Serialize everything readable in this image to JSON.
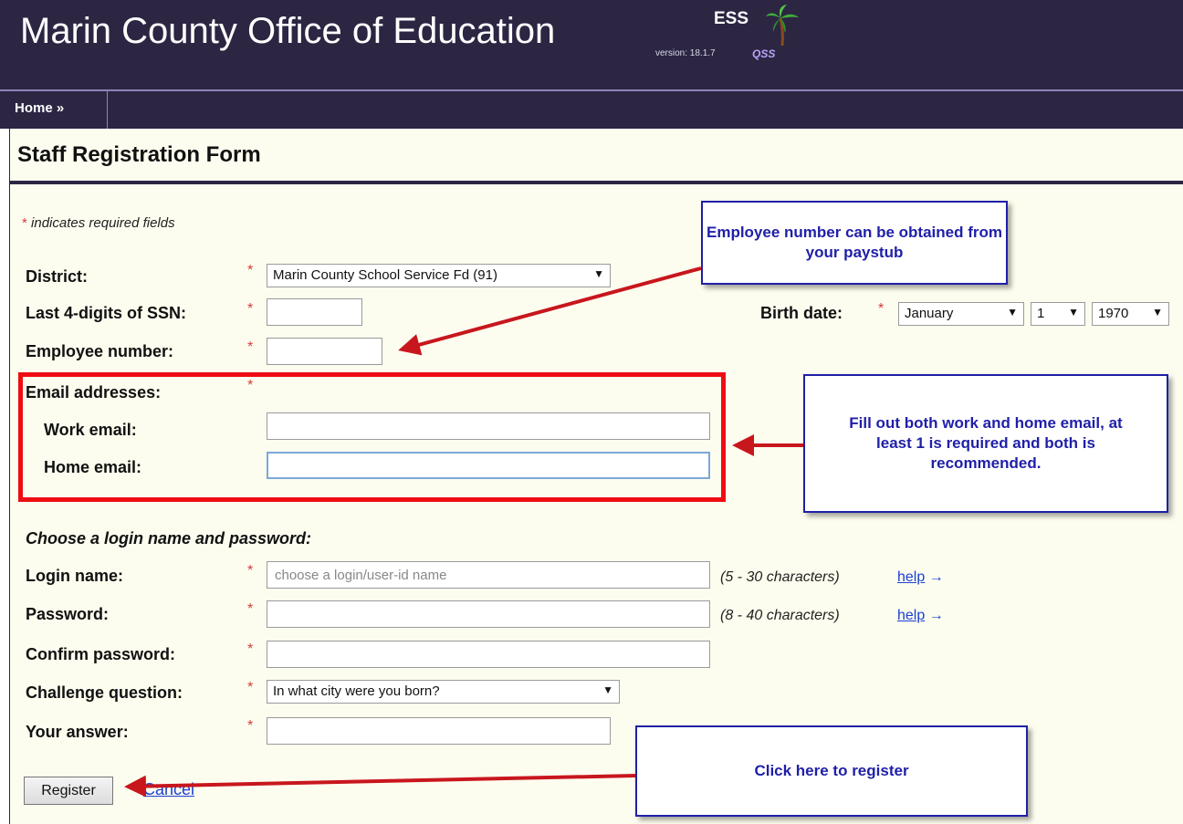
{
  "header": {
    "site_title": "Marin County Office of Education",
    "app_name": "ESS",
    "version": "version: 18.1.7",
    "brand": "QSS"
  },
  "nav": {
    "home": "Home »"
  },
  "form": {
    "title": "Staff Registration Form",
    "required_note": "indicates required fields",
    "required_star": "*",
    "district_label": "District:",
    "district_value": "Marin County School Service Fd (91)",
    "ssn_label": "Last 4-digits of SSN:",
    "birthdate_label": "Birth date:",
    "birth_month": "January",
    "birth_day": "1",
    "birth_year": "1970",
    "employee_label": "Employee number:",
    "email_label": "Email addresses:",
    "work_email_label": "Work email:",
    "home_email_label": "Home email:",
    "login_section": "Choose a login name and password:",
    "login_label": "Login name:",
    "login_placeholder": "choose a login/user-id name",
    "login_hint": "(5 - 30 characters)",
    "password_label": "Password:",
    "password_hint": "(8 - 40 characters)",
    "help_link": "help",
    "help_arrow": "→",
    "confirm_label": "Confirm password:",
    "challenge_label": "Challenge question:",
    "challenge_value": "In what city were you born?",
    "answer_label": "Your answer:",
    "register_button": "Register",
    "cancel_link": "Cancel"
  },
  "callouts": {
    "employee": "Employee number can be obtained from your paystub",
    "email": "Fill out both work and home email, at least 1 is required and both is recommended.",
    "register": "Click here to register"
  },
  "colors": {
    "header_bg": "#2c2643",
    "page_bg": "#fdfdef",
    "callout_border": "#1f1fa8",
    "highlight_red": "#ee0d12",
    "arrow_red": "#c8161d",
    "link": "#1a3fd1"
  }
}
